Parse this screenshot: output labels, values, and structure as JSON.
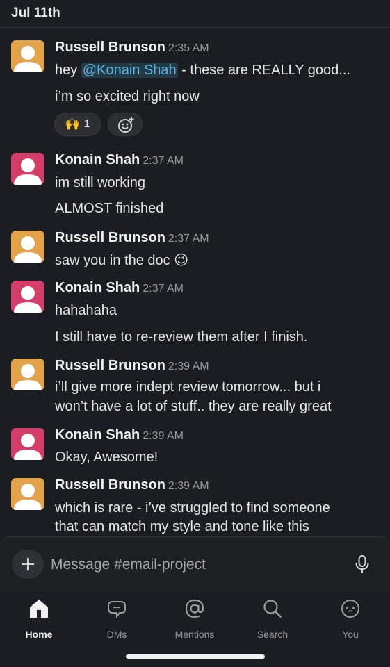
{
  "header": {
    "date": "Jul 11th"
  },
  "messages": [
    {
      "sender": "Russell Brunson",
      "time": "2:35 AM",
      "avatar_color": "#e3a34a",
      "line1_pre": "hey ",
      "mention": "@Konain Shah",
      "line1_post": " - these are REALLY good...",
      "line2": "i’m so excited right now"
    },
    {
      "sender": "Konain Shah",
      "time": "2:37 AM",
      "avatar_color": "#d33d6a",
      "line1": "im still working",
      "line2": "ALMOST finished"
    },
    {
      "sender": "Russell Brunson",
      "time": "2:37 AM",
      "avatar_color": "#e3a34a",
      "line1": "saw you in the doc",
      "emoji": "😉"
    },
    {
      "sender": "Konain Shah",
      "time": "2:37 AM",
      "avatar_color": "#d33d6a",
      "line1": "hahahaha",
      "line2": "I still have to re-review them after I finish."
    },
    {
      "sender": "Russell Brunson",
      "time": "2:39 AM",
      "avatar_color": "#e3a34a",
      "line1": "i’ll give more indept review tomorrow... but i",
      "line2": "won’t have a lot of stuff.. they are really great"
    },
    {
      "sender": "Konain Shah",
      "time": "2:39 AM",
      "avatar_color": "#d33d6a",
      "line1": "Okay, Awesome!"
    },
    {
      "sender": "Russell Brunson",
      "time": "2:39 AM",
      "avatar_color": "#e3a34a",
      "line1": "which is rare - i’ve struggled to find someone",
      "line2": "that can match my style and tone like this"
    }
  ],
  "reaction": {
    "emoji": "🙌",
    "count": "1",
    "icon": "add-reaction-icon"
  },
  "composer": {
    "placeholder": "Message #email-project",
    "plus_icon": "plus-icon",
    "mic_icon": "microphone-icon"
  },
  "tabs": [
    {
      "label": "Home",
      "icon": "home-icon",
      "active": true
    },
    {
      "label": "DMs",
      "icon": "dm-icon",
      "active": false
    },
    {
      "label": "Mentions",
      "icon": "at-icon",
      "active": false
    },
    {
      "label": "Search",
      "icon": "search-icon",
      "active": false
    },
    {
      "label": "You",
      "icon": "profile-icon",
      "active": false
    }
  ]
}
